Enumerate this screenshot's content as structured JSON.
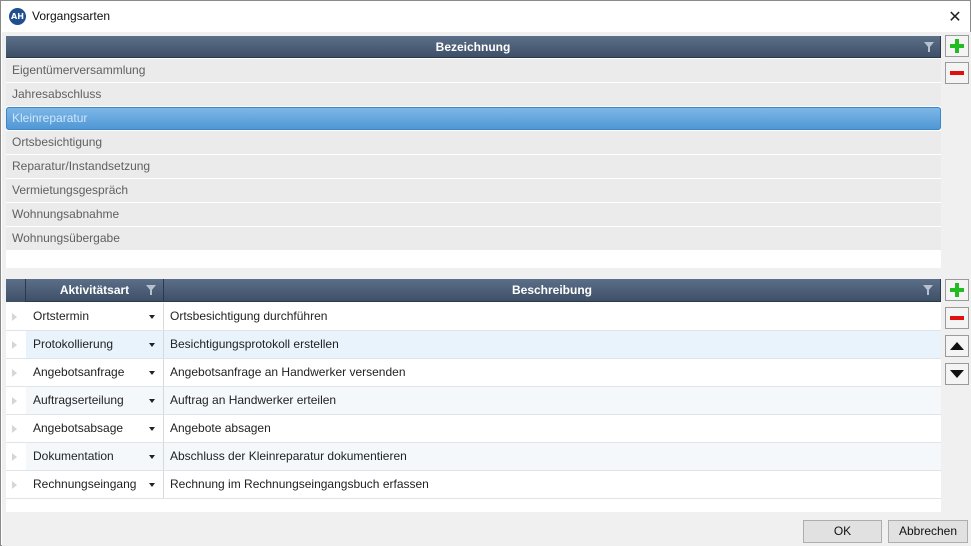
{
  "window": {
    "title": "Vorgangsarten",
    "app_icon": "AH",
    "close": "✕"
  },
  "upper_grid": {
    "column_header": "Bezeichnung",
    "rows": [
      "Eigentümerversammlung",
      "Jahresabschluss",
      "Kleinreparatur",
      "Ortsbesichtigung",
      "Reparatur/Instandsetzung",
      "Vermietungsgespräch",
      "Wohnungsabnahme",
      "Wohnungsübergabe"
    ],
    "selected_index": 2
  },
  "lower_grid": {
    "headers": {
      "activity": "Aktivitätsart",
      "description": "Beschreibung"
    },
    "rows": [
      {
        "activity": "Ortstermin",
        "description": "Ortsbesichtigung durchführen"
      },
      {
        "activity": "Protokollierung",
        "description": "Besichtigungsprotokoll erstellen"
      },
      {
        "activity": "Angebotsanfrage",
        "description": "Angebotsanfrage an Handwerker versenden"
      },
      {
        "activity": "Auftragserteilung",
        "description": "Auftrag an Handwerker erteilen"
      },
      {
        "activity": "Angebotsabsage",
        "description": "Angebote absagen"
      },
      {
        "activity": "Dokumentation",
        "description": "Abschluss der Kleinreparatur dokumentieren"
      },
      {
        "activity": "Rechnungseingang",
        "description": "Rechnung im Rechnungseingangsbuch erfassen"
      }
    ],
    "selected_index": 1
  },
  "footer": {
    "ok_label": "OK",
    "cancel_label": "Abbrechen"
  },
  "icons": {
    "app": "app-logo-icon",
    "close": "close-icon",
    "filter": "filter-icon",
    "add": "plus-icon",
    "remove": "minus-icon",
    "move_up": "arrow-up-icon",
    "move_down": "arrow-down-icon",
    "dropdown": "chevron-down-icon",
    "row_indicator": "row-indicator-icon"
  },
  "colors": {
    "header_bg": "#4a5c75",
    "selection": "#5ea3de",
    "add_green": "#22bb22",
    "remove_red": "#e01010"
  }
}
